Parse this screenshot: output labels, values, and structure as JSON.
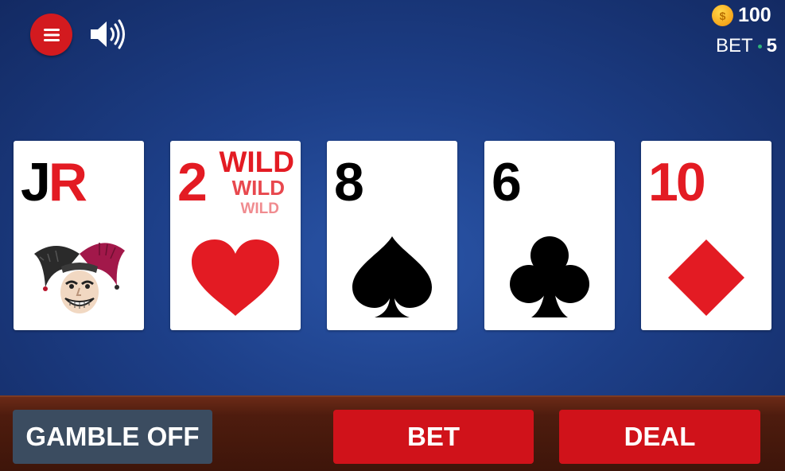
{
  "header": {
    "coins": "100",
    "bet_label": "BET",
    "bet_value": "5",
    "coin_symbol": "$"
  },
  "icons": {
    "menu": "hamburger-menu-icon",
    "sound": "speaker-volume-icon",
    "coin": "gold-coin-icon"
  },
  "cards": [
    {
      "rank_first": "J",
      "rank_second": "R",
      "suit": "joker",
      "color": "mixed"
    },
    {
      "rank": "2",
      "suit": "hearts",
      "color": "red",
      "wild": [
        "WILD",
        "WILD",
        "WILD"
      ]
    },
    {
      "rank": "8",
      "suit": "spades",
      "color": "black"
    },
    {
      "rank": "6",
      "suit": "clubs",
      "color": "black"
    },
    {
      "rank": "10",
      "suit": "diamonds",
      "color": "red"
    }
  ],
  "buttons": {
    "gamble": "GAMBLE OFF",
    "bet": "BET",
    "deal": "DEAL"
  },
  "colors": {
    "red": "#e31b23",
    "button_red": "#d0121a",
    "gamble_bg": "#3b4c60",
    "felt": "#1d3f88"
  }
}
